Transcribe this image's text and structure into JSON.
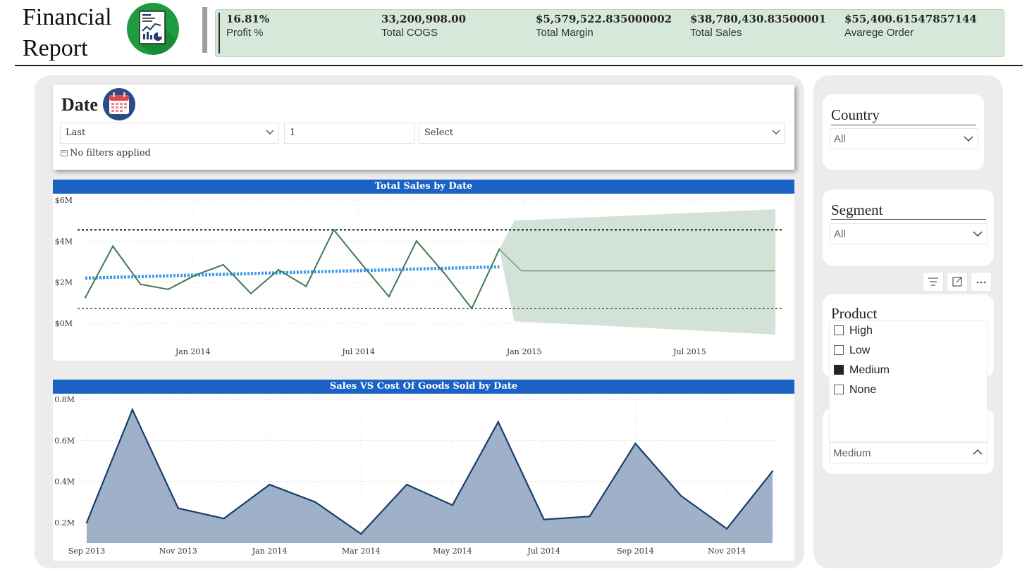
{
  "header": {
    "title_line1": "Financial",
    "title_line2": "Report",
    "colors": {
      "kpi_bg": "#d5e8d9",
      "accent_blue": "#1a62c4"
    }
  },
  "kpis": [
    {
      "value": "16.81%",
      "label": "Profit %"
    },
    {
      "value": "33,200,908.00",
      "label": "Total COGS"
    },
    {
      "value": "$5,579,522.835000002",
      "label": "Total Margin"
    },
    {
      "value": "$38,780,430.83500001",
      "label": "Total Sales"
    },
    {
      "value": "$55,400.61547857144",
      "label": "Avarege Order"
    }
  ],
  "date_slicer": {
    "title": "Date",
    "mode": "Last",
    "count": "1",
    "unit": "Select",
    "status": "No filters applied"
  },
  "country_slicer": {
    "title": "Country",
    "value": "All"
  },
  "segment_slicer": {
    "title": "Segment",
    "value": "All"
  },
  "product_slicer": {
    "title": "Product",
    "options": [
      {
        "label": "High",
        "checked": false
      },
      {
        "label": "Low",
        "checked": false
      },
      {
        "label": "Medium",
        "checked": true
      },
      {
        "label": "None",
        "checked": false
      }
    ],
    "selected": "Medium"
  },
  "chart_data": [
    {
      "type": "line",
      "title": "Total Sales by Date",
      "x_ticks": [
        "Jan 2014",
        "Jul 2014",
        "Jan 2015",
        "Jul 2015"
      ],
      "y_ticks": [
        "$0M",
        "$2M",
        "$4M",
        "$6M"
      ],
      "ylim": [
        0,
        6
      ],
      "x": [
        "Sep 2013",
        "Oct 2013",
        "Nov 2013",
        "Dec 2013",
        "Jan 2014",
        "Feb 2014",
        "Mar 2014",
        "Apr 2014",
        "May 2014",
        "Jun 2014",
        "Jul 2014",
        "Aug 2014",
        "Sep 2014",
        "Oct 2014",
        "Nov 2014",
        "Dec 2014"
      ],
      "series": [
        {
          "values": [
            1.25,
            3.75,
            1.9,
            1.65,
            2.35,
            2.85,
            1.45,
            2.6,
            1.8,
            4.55,
            2.9,
            1.3,
            4.0,
            2.45,
            0.72,
            3.6
          ]
        }
      ],
      "forecast": {
        "x": [
          "Jan 2015",
          "Oct 2015"
        ],
        "value": 2.55,
        "lower": [
          0.1,
          -0.55
        ],
        "upper": [
          5.0,
          5.55
        ]
      },
      "trend": [
        2.2,
        2.75
      ],
      "ref_lines": [
        4.55,
        0.72
      ],
      "grid": true
    },
    {
      "type": "area",
      "title": "Sales VS Cost Of Goods Sold by Date",
      "x_ticks": [
        "Sep 2013",
        "Nov 2013",
        "Jan 2014",
        "Mar 2014",
        "May 2014",
        "Jul 2014",
        "Sep 2014",
        "Nov 2014"
      ],
      "y_ticks": [
        "0.2M",
        "0.4M",
        "0.6M",
        "0.8M"
      ],
      "ylim": [
        0.2,
        0.8
      ],
      "x": [
        "Sep 2013",
        "Oct 2013",
        "Nov 2013",
        "Dec 2013",
        "Jan 2014",
        "Feb 2014",
        "Mar 2014",
        "Apr 2014",
        "May 2014",
        "Jun 2014",
        "Jul 2014",
        "Aug 2014",
        "Sep 2014",
        "Oct 2014",
        "Nov 2014",
        "Dec 2014"
      ],
      "series": [
        {
          "values": [
            0.2,
            0.75,
            0.27,
            0.22,
            0.385,
            0.3,
            0.145,
            0.385,
            0.285,
            0.69,
            0.215,
            0.23,
            0.585,
            0.33,
            0.17,
            0.45
          ]
        }
      ],
      "grid": true
    }
  ]
}
